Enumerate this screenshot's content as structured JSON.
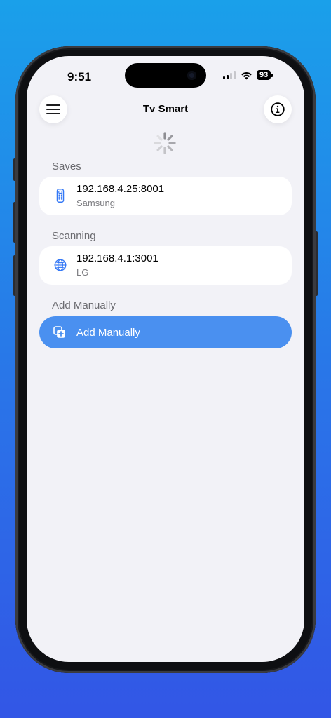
{
  "status_bar": {
    "time": "9:51",
    "battery": "93"
  },
  "header": {
    "title": "Tv Smart",
    "menu_icon": "hamburger-menu-icon",
    "info_icon": "info-circle-icon"
  },
  "loading_indicator": "activity-spinner",
  "sections": {
    "saves": {
      "label": "Saves",
      "items": [
        {
          "ip": "192.168.4.25:8001",
          "brand": "Samsung",
          "icon": "remote-control-icon"
        }
      ]
    },
    "scanning": {
      "label": "Scanning",
      "items": [
        {
          "ip": "192.168.4.1:3001",
          "brand": "LG",
          "icon": "globe-icon"
        }
      ]
    },
    "add_manually": {
      "label": "Add Manually",
      "button_label": "Add Manually",
      "icon": "add-square-icon"
    }
  },
  "colors": {
    "accent": "#4a90f0",
    "screen_background": "#f2f2f7",
    "card_background": "#ffffff",
    "secondary_text": "#7c7c80"
  }
}
